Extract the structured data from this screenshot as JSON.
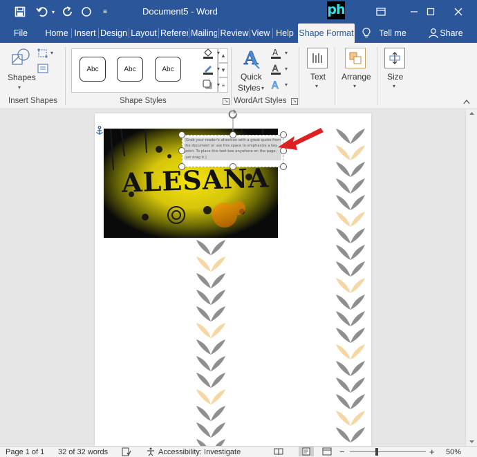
{
  "titlebar": {
    "document_title": "Document5  -  Word",
    "logo_text": "ph",
    "quick_access": [
      "save-icon",
      "undo-icon",
      "redo-icon",
      "circle-icon",
      "customize-icon"
    ]
  },
  "tabs": [
    {
      "label": "File"
    },
    {
      "label": "Home"
    },
    {
      "label": "Insert"
    },
    {
      "label": "Design"
    },
    {
      "label": "Layout"
    },
    {
      "label": "Referen"
    },
    {
      "label": "Mailing"
    },
    {
      "label": "Review"
    },
    {
      "label": "View"
    },
    {
      "label": "Help"
    },
    {
      "label": "Shape Format"
    },
    {
      "label": "Tell me"
    },
    {
      "label": "Share"
    }
  ],
  "ribbon": {
    "insert_shapes": {
      "label": "Insert Shapes",
      "shapes_label": "Shapes"
    },
    "shape_styles": {
      "label": "Shape Styles",
      "samples": [
        "Abc",
        "Abc",
        "Abc"
      ]
    },
    "wordart_styles": {
      "label": "WordArt Styles",
      "quick_styles_line1": "Quick",
      "quick_styles_line2": "Styles"
    },
    "text_label": "Text",
    "arrange_label": "Arrange",
    "size_label": "Size"
  },
  "document": {
    "image_text": "ALESANA",
    "quote_text": "[Grab your reader's attention with a great quote from the document or use this space to emphasize a key point. To place this text box anywhere on the page, just drag it.]"
  },
  "statusbar": {
    "page": "Page 1 of 1",
    "words": "32 of 32 words",
    "accessibility": "Accessibility: Investigate",
    "zoom": "50%"
  },
  "colors": {
    "accent": "#2b579a",
    "arrow": "#e02020",
    "leaf_gray": "#8f8f8f",
    "leaf_peach": "#f7d6a4"
  }
}
